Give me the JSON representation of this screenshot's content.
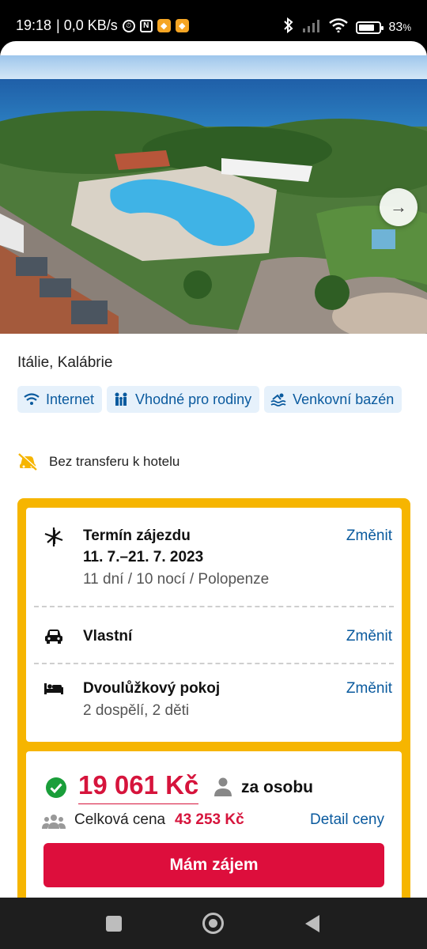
{
  "status_bar": {
    "time": "19:18",
    "speed": "| 0,0 KB/s",
    "battery": "83",
    "battery_unit": "%",
    "battery_level": 0.83,
    "icons": [
      "alarm-icon",
      "nfc-icon",
      "app-notification-icon",
      "app-notification-icon",
      "bluetooth-icon",
      "signal-icon",
      "wifi-icon",
      "battery-icon"
    ]
  },
  "hero": {
    "image": "aerial-resort-pool-photo",
    "next_icon": "→"
  },
  "hotel": {
    "location": "Itálie, Kalábrie"
  },
  "amenities": [
    {
      "label": "Internet",
      "icon": "wifi-icon"
    },
    {
      "label": "Vhodné pro rodiny",
      "icon": "family-icon"
    },
    {
      "label": "Venkovní bazén",
      "icon": "pool-icon"
    }
  ],
  "transfer": {
    "label": "Bez transferu k hotelu",
    "icon": "no-transfer-icon"
  },
  "booking": {
    "term": {
      "title": "Termín zájezdu",
      "dates": "11. 7.–21. 7. 2023",
      "details": "11 dní / 10 nocí / Polopenze",
      "change": "Změnit",
      "icon": "plane-icon"
    },
    "transport": {
      "title": "Vlastní",
      "change": "Změnit",
      "icon": "car-icon"
    },
    "room": {
      "title": "Dvoulůžkový pokoj",
      "guests": "2 dospělí, 2 děti",
      "change": "Změnit",
      "icon": "bed-icon"
    }
  },
  "price": {
    "per_person": "19 061 Kč",
    "per_person_label": "za osobu",
    "total_label": "Celková cena",
    "total": "43 253 Kč",
    "detail_link": "Detail ceny",
    "cta": "Mám zájem"
  },
  "colors": {
    "accent_blue": "#0a5a9e",
    "price_red": "#d6143c",
    "cta_red": "#dd0e3c",
    "booking_frame": "#f6b500",
    "tag_bg": "#e6f1fb",
    "check_green": "#1a9e3a"
  },
  "nav": {
    "buttons": [
      "recents-button",
      "home-button",
      "back-button"
    ]
  }
}
